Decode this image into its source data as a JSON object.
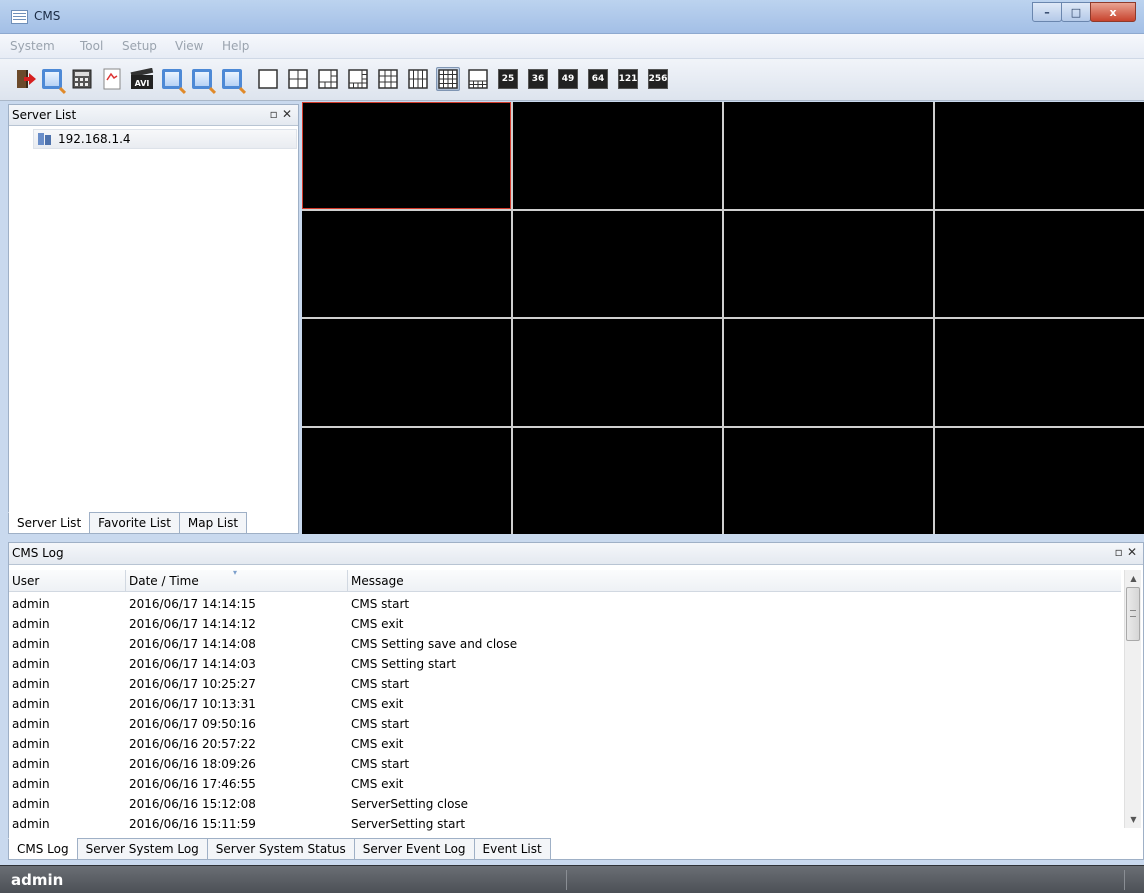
{
  "window": {
    "title": "CMS",
    "minimize": "–",
    "maximize": "□",
    "close": "x"
  },
  "menu": [
    "System",
    "Tool",
    "Setup",
    "View",
    "Help"
  ],
  "toolbar": {
    "pressed_layout": "16-split",
    "layout_labels": [
      "25",
      "36",
      "49",
      "64",
      "121",
      "256"
    ],
    "avi_label": "AVI"
  },
  "server_list": {
    "title": "Server List",
    "float_icon": "▫",
    "close_icon": "✕",
    "items": [
      "192.168.1.4"
    ],
    "tabs": [
      "Server List",
      "Favorite List",
      "Map List"
    ],
    "active_tab": "Server List"
  },
  "video": {
    "rows": 4,
    "cols": 4,
    "selected_cell": 0,
    "border_color": "#d23a2a"
  },
  "log": {
    "title": "CMS Log",
    "columns": [
      "User",
      "Date / Time",
      "Message"
    ],
    "rows": [
      [
        "admin",
        "2016/06/17 14:14:15",
        "CMS start"
      ],
      [
        "admin",
        "2016/06/17 14:14:12",
        "CMS exit"
      ],
      [
        "admin",
        "2016/06/17 14:14:08",
        "CMS Setting save and close"
      ],
      [
        "admin",
        "2016/06/17 14:14:03",
        "CMS Setting start"
      ],
      [
        "admin",
        "2016/06/17 10:25:27",
        "CMS start"
      ],
      [
        "admin",
        "2016/06/17 10:13:31",
        "CMS exit"
      ],
      [
        "admin",
        "2016/06/17 09:50:16",
        "CMS start"
      ],
      [
        "admin",
        "2016/06/16 20:57:22",
        "CMS exit"
      ],
      [
        "admin",
        "2016/06/16 18:09:26",
        "CMS start"
      ],
      [
        "admin",
        "2016/06/16 17:46:55",
        "CMS exit"
      ],
      [
        "admin",
        "2016/06/16 15:12:08",
        "ServerSetting close"
      ],
      [
        "admin",
        "2016/06/16 15:11:59",
        "ServerSetting start"
      ]
    ],
    "tabs": [
      "CMS Log",
      "Server System Log",
      "Server System Status",
      "Server Event Log",
      "Event List"
    ],
    "active_tab": "CMS Log"
  },
  "status": {
    "user": "admin"
  }
}
